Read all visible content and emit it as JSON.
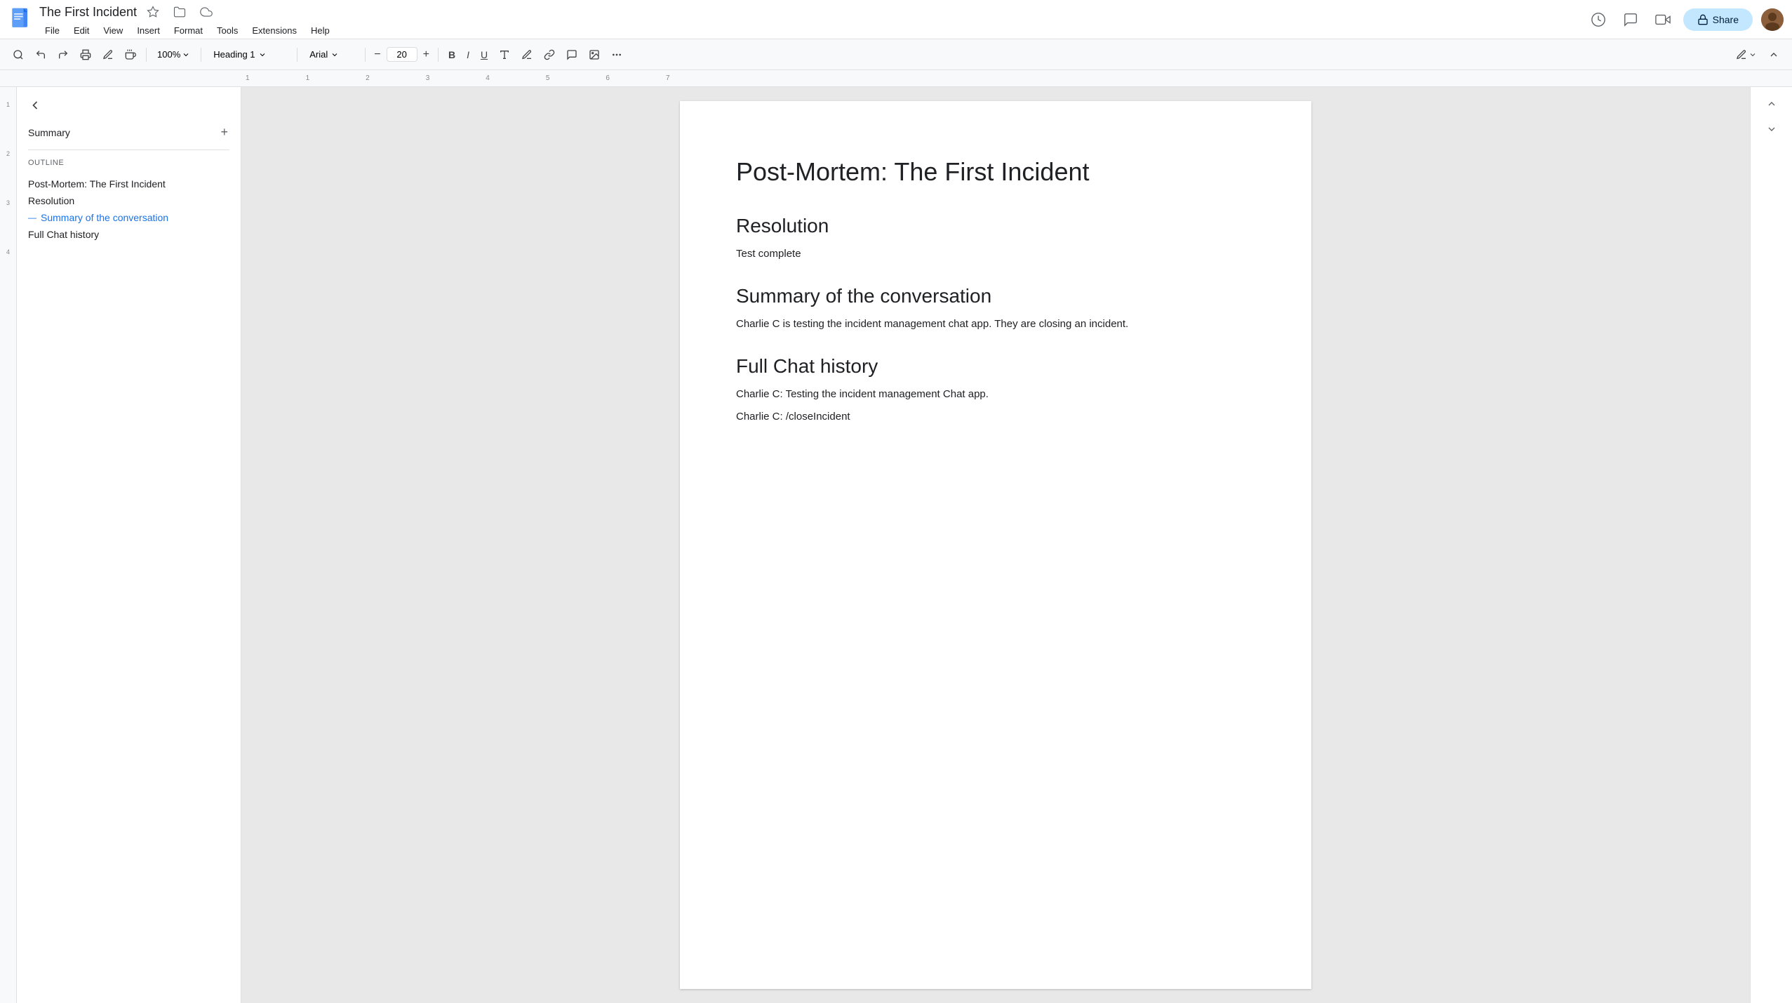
{
  "app": {
    "doc_icon_color": "#4285f4",
    "title": "The First Incident",
    "menu": [
      "File",
      "Edit",
      "View",
      "Insert",
      "Format",
      "Tools",
      "Extensions",
      "Help"
    ],
    "share_label": "Share",
    "toolbar": {
      "zoom": "100%",
      "style": "Heading 1",
      "font": "Arial",
      "font_size": "20",
      "bold": "B",
      "italic": "I",
      "underline": "U"
    }
  },
  "sidebar": {
    "section_title": "Summary",
    "add_label": "+",
    "outline_label": "Outline",
    "outline_items": [
      {
        "id": "item-1",
        "text": "Post-Mortem: The First Incident",
        "active": false
      },
      {
        "id": "item-2",
        "text": "Resolution",
        "active": false
      },
      {
        "id": "item-3",
        "text": "Summary of the conversation",
        "active": true
      },
      {
        "id": "item-4",
        "text": "Full Chat history",
        "active": false
      }
    ]
  },
  "document": {
    "main_title": "Post-Mortem: The First Incident",
    "sections": [
      {
        "id": "section-resolution",
        "heading": "Resolution",
        "content": "Test complete"
      },
      {
        "id": "section-summary",
        "heading": "Summary of the conversation",
        "content": "Charlie C is testing the incident management chat app. They are closing an incident."
      },
      {
        "id": "section-chat",
        "heading": "Full Chat history",
        "lines": [
          "Charlie C: Testing the incident management Chat app.",
          "Charlie C: /closeIncident"
        ]
      }
    ]
  }
}
